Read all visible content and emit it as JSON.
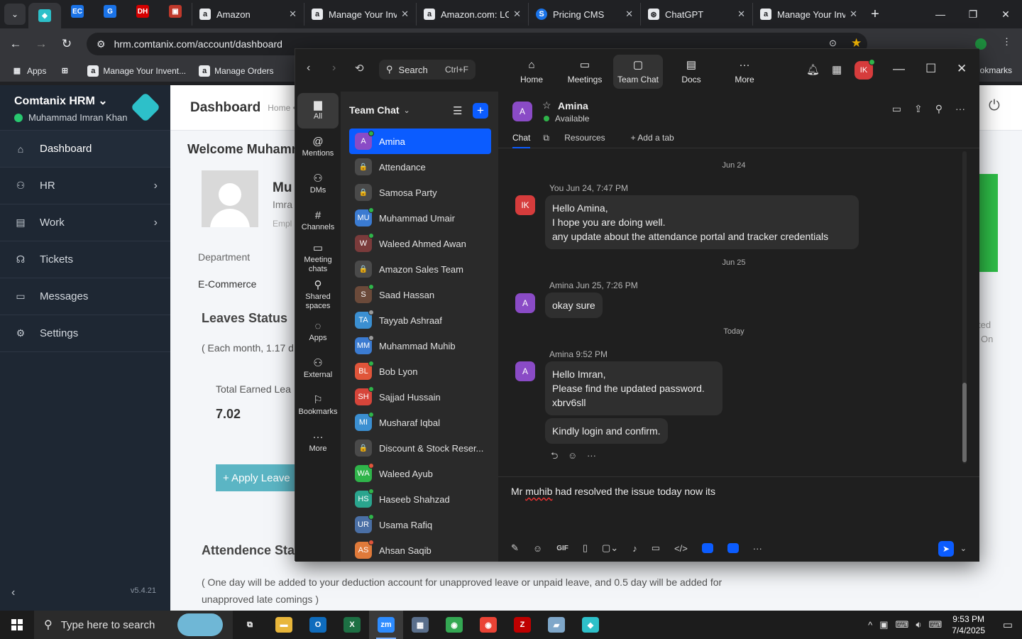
{
  "browser": {
    "pinned_tabs": [
      {
        "name": "pinned-tab-1",
        "glyph": "◆",
        "color": "#2dc0c9"
      },
      {
        "name": "pinned-tab-2",
        "glyph": "EC",
        "color": "#1a73e8"
      },
      {
        "name": "pinned-tab-3",
        "glyph": "G",
        "color": "#1a73e8"
      },
      {
        "name": "pinned-tab-4",
        "glyph": "DH",
        "color": "#d50000"
      },
      {
        "name": "pinned-tab-5",
        "glyph": "▣",
        "color": "#c0392b"
      }
    ],
    "tabs": [
      {
        "title": "Amazon",
        "icon": "a"
      },
      {
        "title": "Manage Your Inventory",
        "icon": "a"
      },
      {
        "title": "Amazon.com: LG",
        "icon": "a"
      },
      {
        "title": "Pricing CMS",
        "icon": "S"
      },
      {
        "title": "ChatGPT",
        "icon": "⊛"
      },
      {
        "title": "Manage Your Inventory",
        "icon": "a"
      }
    ],
    "url": "hrm.comtanix.com/account/dashboard",
    "bookmarks": [
      {
        "label": "Apps",
        "icon": "▦"
      },
      {
        "label": "",
        "icon": "⊞"
      },
      {
        "label": "Manage Your Invent...",
        "icon": "a"
      },
      {
        "label": "Manage Orders",
        "icon": "a"
      }
    ],
    "bookmarks_right": "okmarks"
  },
  "hrm": {
    "brand": "Comtanix HRM",
    "user": "Muhammad Imran Khan",
    "nav": [
      {
        "label": "Dashboard",
        "icon": "⌂",
        "chevron": false
      },
      {
        "label": "HR",
        "icon": "⚇",
        "chevron": true
      },
      {
        "label": "Work",
        "icon": "▤",
        "chevron": true
      },
      {
        "label": "Tickets",
        "icon": "☊",
        "chevron": false
      },
      {
        "label": "Messages",
        "icon": "▭",
        "chevron": false
      },
      {
        "label": "Settings",
        "icon": "⚙",
        "chevron": false
      }
    ],
    "version": "v5.4.21",
    "page_title": "Dashboard",
    "breadcrumb": "Home •",
    "welcome": "Welcome Muhamm",
    "profile_name": "Mu",
    "profile_sub": "Imra",
    "profile_role": "Empl",
    "department_label": "Department",
    "department_value": "E-Commerce",
    "leaves_title": "Leaves Status",
    "leaves_note": "( Each month, 1.17 d",
    "earned_label": "Total Earned Lea",
    "earned_value": "7.02",
    "apply_label": "+ Apply Leave",
    "attendance_title": "Attendence Sta",
    "attendance_note": "( One day will be added to your deduction account for unapproved leave or unpaid leave, and 0.5 day will be added for unapproved late comings )",
    "right_edge_1": "ted",
    "right_edge_2": "On"
  },
  "zoom": {
    "search_label": "Search",
    "search_hint": "Ctrl+F",
    "top_tabs": [
      {
        "label": "Home",
        "icon": "⌂",
        "name": "tab-home"
      },
      {
        "label": "Meetings",
        "icon": "▭",
        "name": "tab-meetings"
      },
      {
        "label": "Team Chat",
        "icon": "▢",
        "name": "tab-team-chat"
      },
      {
        "label": "Docs",
        "icon": "▤",
        "name": "tab-docs"
      },
      {
        "label": "More",
        "icon": "···",
        "name": "tab-more"
      }
    ],
    "user_initials": "IK",
    "rail": [
      {
        "label": "All",
        "icon": "▆",
        "name": "rail-all"
      },
      {
        "label": "Mentions",
        "icon": "@",
        "name": "rail-mentions"
      },
      {
        "label": "DMs",
        "icon": "⚇",
        "name": "rail-dms"
      },
      {
        "label": "Channels",
        "icon": "#",
        "name": "rail-channels"
      },
      {
        "label": "Meeting chats",
        "icon": "▭",
        "name": "rail-meeting-chats"
      },
      {
        "label": "Shared spaces",
        "icon": "⚲",
        "name": "rail-shared-spaces"
      },
      {
        "label": "Apps",
        "icon": "◌",
        "name": "rail-apps"
      },
      {
        "label": "External",
        "icon": "⚇",
        "name": "rail-external"
      },
      {
        "label": "Bookmarks",
        "icon": "⚐",
        "name": "rail-bookmarks"
      },
      {
        "label": "More",
        "icon": "···",
        "name": "rail-more"
      }
    ],
    "list_title": "Team Chat",
    "contacts": [
      {
        "name": "Amina",
        "initials": "A",
        "color": "#8a4bc6",
        "status": "online",
        "lock": false
      },
      {
        "name": "Attendance",
        "initials": "🔒",
        "color": "#4a4a4a",
        "status": "",
        "lock": true
      },
      {
        "name": "Samosa Party",
        "initials": "🔒",
        "color": "#4a4a4a",
        "status": "",
        "lock": true
      },
      {
        "name": "Muhammad Umair",
        "initials": "MU",
        "color": "#3b7bd1",
        "status": "online",
        "lock": false
      },
      {
        "name": "Waleed Ahmed Awan",
        "initials": "W",
        "color": "#7a3b3b",
        "status": "online",
        "lock": false
      },
      {
        "name": "Amazon Sales Team",
        "initials": "🔒",
        "color": "#4a4a4a",
        "status": "",
        "lock": true
      },
      {
        "name": "Saad Hassan",
        "initials": "S",
        "color": "#6b4a3a",
        "status": "online",
        "lock": false
      },
      {
        "name": "Tayyab Ashraaf",
        "initials": "TA",
        "color": "#3b8fd1",
        "status": "away",
        "lock": false
      },
      {
        "name": "Muhammad Muhib",
        "initials": "MM",
        "color": "#3b7bd1",
        "status": "away",
        "lock": false
      },
      {
        "name": "Bob Lyon",
        "initials": "BL",
        "color": "#e0553a",
        "status": "online",
        "lock": false
      },
      {
        "name": "Sajjad Hussain",
        "initials": "SH",
        "color": "#d6453a",
        "status": "online",
        "lock": false
      },
      {
        "name": "Musharaf Iqbal",
        "initials": "MI",
        "color": "#3b8fd1",
        "status": "online",
        "lock": false
      },
      {
        "name": "Discount & Stock Reser...",
        "initials": "🔒",
        "color": "#4a4a4a",
        "status": "",
        "lock": true
      },
      {
        "name": "Waleed Ayub",
        "initials": "WA",
        "color": "#2fb44a",
        "status": "busy",
        "lock": false
      },
      {
        "name": "Haseeb Shahzad",
        "initials": "HS",
        "color": "#2aa58e",
        "status": "online",
        "lock": false
      },
      {
        "name": "Usama Rafiq",
        "initials": "UR",
        "color": "#4a6fa5",
        "status": "online",
        "lock": false
      },
      {
        "name": "Ahsan Saqib",
        "initials": "AS",
        "color": "#e07a3a",
        "status": "busy",
        "lock": false
      }
    ],
    "chat": {
      "name": "Amina",
      "initial": "A",
      "status": "Available",
      "tabs": [
        "Chat",
        "Resources",
        "+ Add a tab"
      ],
      "messages": [
        {
          "date": "Jun 24"
        },
        {
          "meta": "You Jun 24, 7:47 PM",
          "avatar": "IK",
          "lines": [
            "Hello Amina,",
            "I hope you are doing well.",
            "any update about the attendance portal and tracker credentials"
          ]
        },
        {
          "date": "Jun 25"
        },
        {
          "meta": "Amina Jun 25, 7:26 PM",
          "avatar": "A",
          "lines": [
            "okay sure"
          ]
        },
        {
          "date": "Today"
        },
        {
          "meta": "Amina 9:52 PM",
          "avatar": "A",
          "lines": [
            "Hello Imran,",
            "Please find the updated password.",
            "xbrv6sll"
          ]
        },
        {
          "lines": [
            "Kindly login and confirm."
          ]
        }
      ],
      "draft_prefix": "Mr ",
      "draft_misspelled": "muhib",
      "draft_rest": " had resolved the issue today now its"
    }
  },
  "taskbar": {
    "search_placeholder": "Type here to search",
    "apps": [
      {
        "name": "task-view",
        "glyph": "⧉",
        "color": "#1c1c1c"
      },
      {
        "name": "file-explorer",
        "glyph": "▬",
        "color": "#e8b63a"
      },
      {
        "name": "outlook",
        "glyph": "O",
        "color": "#0f6cbd"
      },
      {
        "name": "excel",
        "glyph": "X",
        "color": "#1d7044"
      },
      {
        "name": "zoom",
        "glyph": "zm",
        "color": "#2d8cff"
      },
      {
        "name": "calculator",
        "glyph": "▦",
        "color": "#5a6f8c"
      },
      {
        "name": "chrome",
        "glyph": "◉",
        "color": "#34a853"
      },
      {
        "name": "chrome-2",
        "glyph": "◉",
        "color": "#ea4335"
      },
      {
        "name": "filezilla",
        "glyph": "Z",
        "color": "#bf0000"
      },
      {
        "name": "notes",
        "glyph": "▰",
        "color": "#7fa7c9"
      },
      {
        "name": "hrm-app",
        "glyph": "◆",
        "color": "#2dc0c9"
      }
    ],
    "time": "9:53 PM",
    "date": "7/4/2025"
  }
}
